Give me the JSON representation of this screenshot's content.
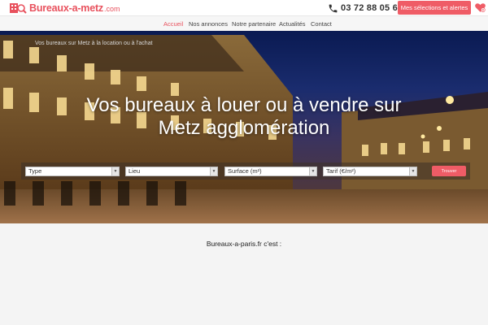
{
  "header": {
    "logo_text": "Bureaux-a-metz",
    "logo_suffix": ".com",
    "phone": "03 72 88 05 61",
    "alerts_button": "Mes sélections et alertes"
  },
  "nav": {
    "items": [
      {
        "label": "Accueil",
        "active": true
      },
      {
        "label": "Nos annonces",
        "active": false
      },
      {
        "label": "Notre partenaire",
        "active": false
      },
      {
        "label": "Actualités",
        "active": false
      },
      {
        "label": "Contact",
        "active": false
      }
    ]
  },
  "hero": {
    "breadcrumb": "Vos bureaux sur Metz à la location ou à l'achat",
    "title_line1": "Vos bureaux à louer ou à vendre sur",
    "title_line2": "Metz agglomération"
  },
  "search": {
    "type": "Type",
    "lieu": "Lieu",
    "surface": "Surface (m²)",
    "tarif": "Tarif (€/m²)",
    "button": "Trouver"
  },
  "main": {
    "section_title": "Bureaux-a-paris.fr c'est :"
  },
  "colors": {
    "accent": "#ef5c66",
    "logo": "#e8515d"
  }
}
